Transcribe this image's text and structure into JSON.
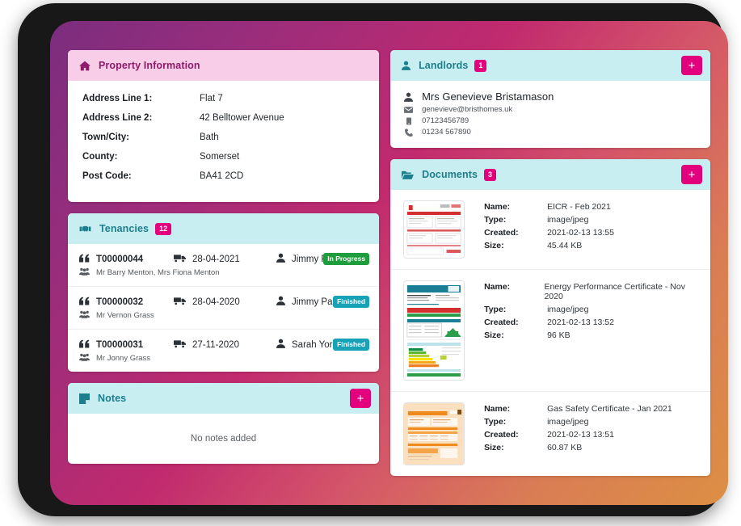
{
  "property_info": {
    "title": "Property Information",
    "icon": "home-icon",
    "rows": [
      {
        "label": "Address Line 1:",
        "value": "Flat 7"
      },
      {
        "label": "Address Line 2:",
        "value": "42 Belltower Avenue"
      },
      {
        "label": "Town/City:",
        "value": "Bath"
      },
      {
        "label": "County:",
        "value": "Somerset"
      },
      {
        "label": "Post Code:",
        "value": "BA41 2CD"
      }
    ]
  },
  "tenancies": {
    "title": "Tenancies",
    "icon": "handshake-icon",
    "count": "12",
    "rows": [
      {
        "reference": "T00000044",
        "date": "28-04-2021",
        "agent": "Jimmy Parsons",
        "tenants": "Mr Barry Menton, Mrs Fiona Menton",
        "status": "In Progress",
        "status_color": "#1f9d3d"
      },
      {
        "reference": "T00000032",
        "date": "28-04-2020",
        "agent": "Jimmy Parsons",
        "tenants": "Mr Vernon Grass",
        "status": "Finished",
        "status_color": "#17a2b8"
      },
      {
        "reference": "T00000031",
        "date": "27-11-2020",
        "agent": "Sarah York",
        "tenants": "Mr Jonny Grass",
        "status": "Finished",
        "status_color": "#17a2b8"
      }
    ]
  },
  "notes": {
    "title": "Notes",
    "icon": "sticky-note-icon",
    "add_label": "+",
    "empty_text": "No notes added"
  },
  "landlords": {
    "title": "Landlords",
    "icon": "user-icon",
    "count": "1",
    "add_label": "+",
    "entries": [
      {
        "name": "Mrs Genevieve Bristamason",
        "email": "genevieve@bristhomes.uk",
        "mobile": "07123456789",
        "phone": "01234 567890"
      }
    ]
  },
  "documents": {
    "title": "Documents",
    "icon": "folder-open-icon",
    "count": "3",
    "add_label": "+",
    "field_labels": {
      "name": "Name:",
      "type": "Type:",
      "created": "Created:",
      "size": "Size:"
    },
    "rows": [
      {
        "name": "EICR - Feb 2021",
        "type": "image/jpeg",
        "created": "2021-02-13 13:55",
        "size": "45.44 KB",
        "thumbnail": "eicr-certificate-thumbnail"
      },
      {
        "name": "Energy Performance Certificate - Nov 2020",
        "type": "image/jpeg",
        "created": "2021-02-13 13:52",
        "size": "96 KB",
        "thumbnail": "epc-certificate-thumbnail"
      },
      {
        "name": "Gas Safety Certificate - Jan 2021",
        "type": "image/jpeg",
        "created": "2021-02-13 13:51",
        "size": "60.87 KB",
        "thumbnail": "gas-safety-certificate-thumbnail"
      }
    ]
  },
  "theme": {
    "accent_pink": "#e3007c",
    "header_pink": "#f7cde7",
    "header_pink_text": "#8f1b6b",
    "header_cyan": "#c9eef2",
    "header_cyan_text": "#1d7f8c",
    "bg_gradient_start": "#7b2d7f",
    "bg_gradient_end": "#dd8f43",
    "frame": "#181818"
  }
}
